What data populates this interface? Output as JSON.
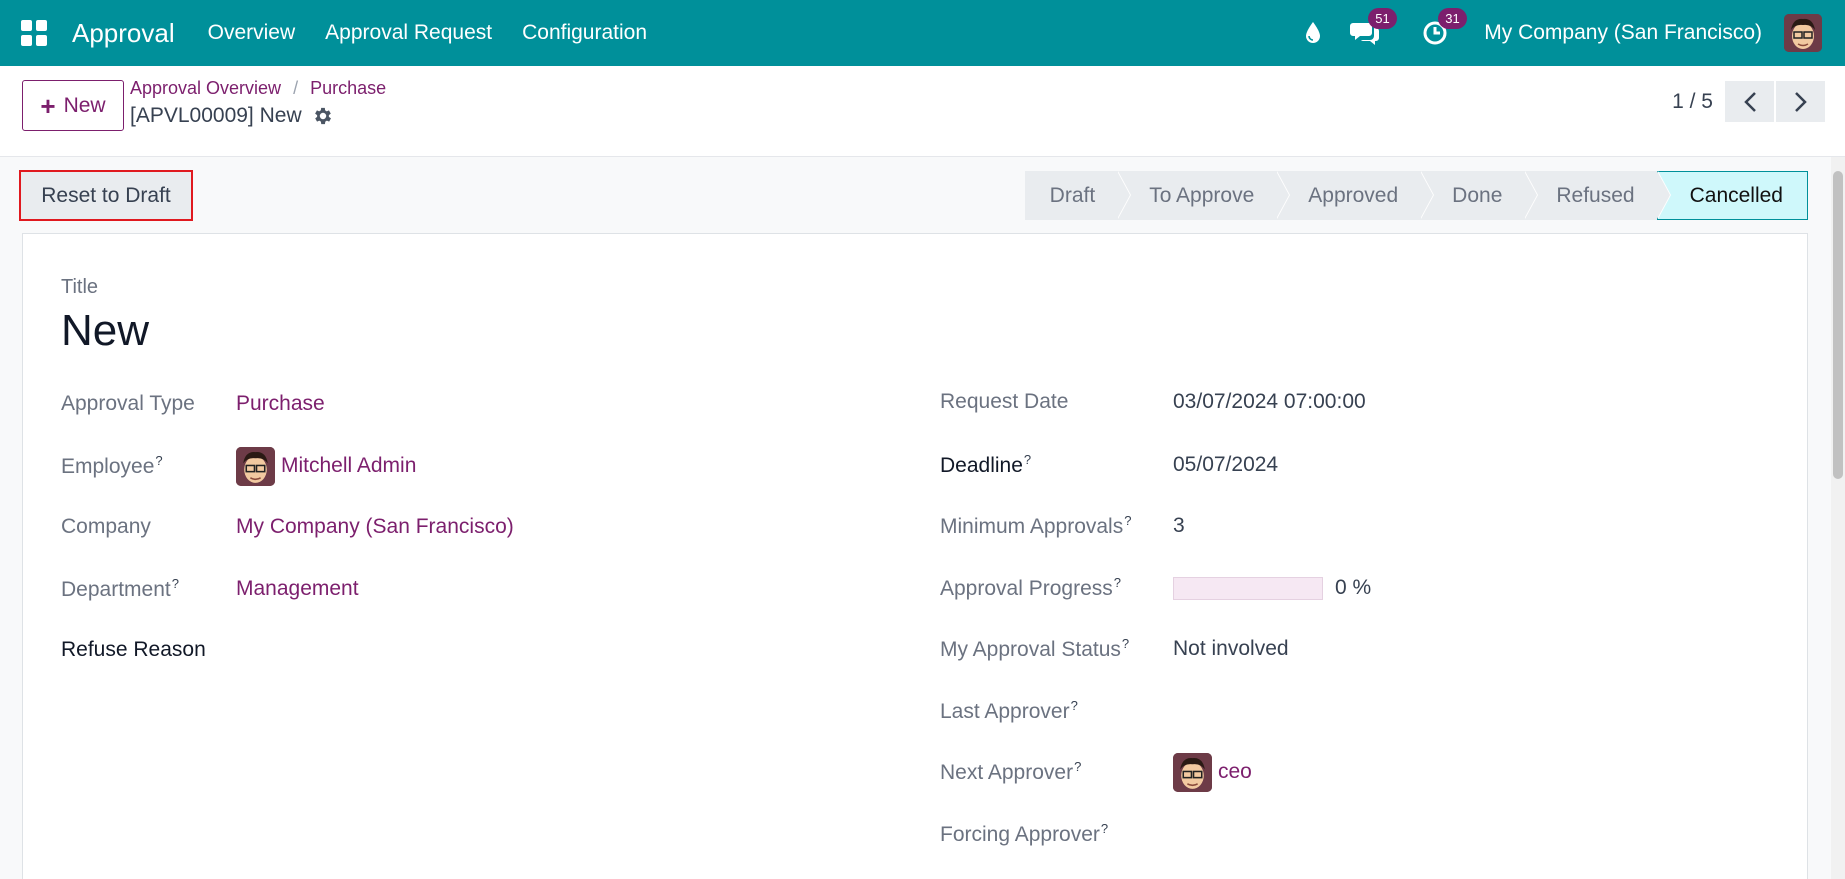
{
  "navbar": {
    "app_name": "Approval",
    "menu": [
      "Overview",
      "Approval Request",
      "Configuration"
    ],
    "messages_count": "51",
    "activities_count": "31",
    "company": "My Company (San Francisco)"
  },
  "control_panel": {
    "new_label": "New",
    "breadcrumb": [
      "Approval Overview",
      "Purchase"
    ],
    "record_title": "[APVL00009] New",
    "pager": "1 / 5"
  },
  "status": {
    "reset_label": "Reset to Draft",
    "stages": [
      "Draft",
      "To Approve",
      "Approved",
      "Done",
      "Refused",
      "Cancelled"
    ],
    "active_stage": "Cancelled"
  },
  "form": {
    "title_label": "Title",
    "title_value": "New",
    "left": {
      "approval_type_label": "Approval Type",
      "approval_type": "Purchase",
      "employee_label": "Employee",
      "employee": "Mitchell Admin",
      "company_label": "Company",
      "company": "My Company (San Francisco)",
      "department_label": "Department",
      "department": "Management",
      "refuse_reason_label": "Refuse Reason"
    },
    "right": {
      "request_date_label": "Request Date",
      "request_date": "03/07/2024 07:00:00",
      "deadline_label": "Deadline",
      "deadline": "05/07/2024",
      "min_approvals_label": "Minimum Approvals",
      "min_approvals": "3",
      "approval_progress_label": "Approval Progress",
      "approval_progress": "0 %",
      "my_status_label": "My Approval Status",
      "my_status": "Not involved",
      "last_approver_label": "Last Approver",
      "next_approver_label": "Next Approver",
      "next_approver": "ceo",
      "forcing_approver_label": "Forcing Approver"
    },
    "help_mark": "?"
  },
  "colors": {
    "navbar": "#00909a",
    "link": "#7c1f6d",
    "highlight": "#e0191f"
  }
}
